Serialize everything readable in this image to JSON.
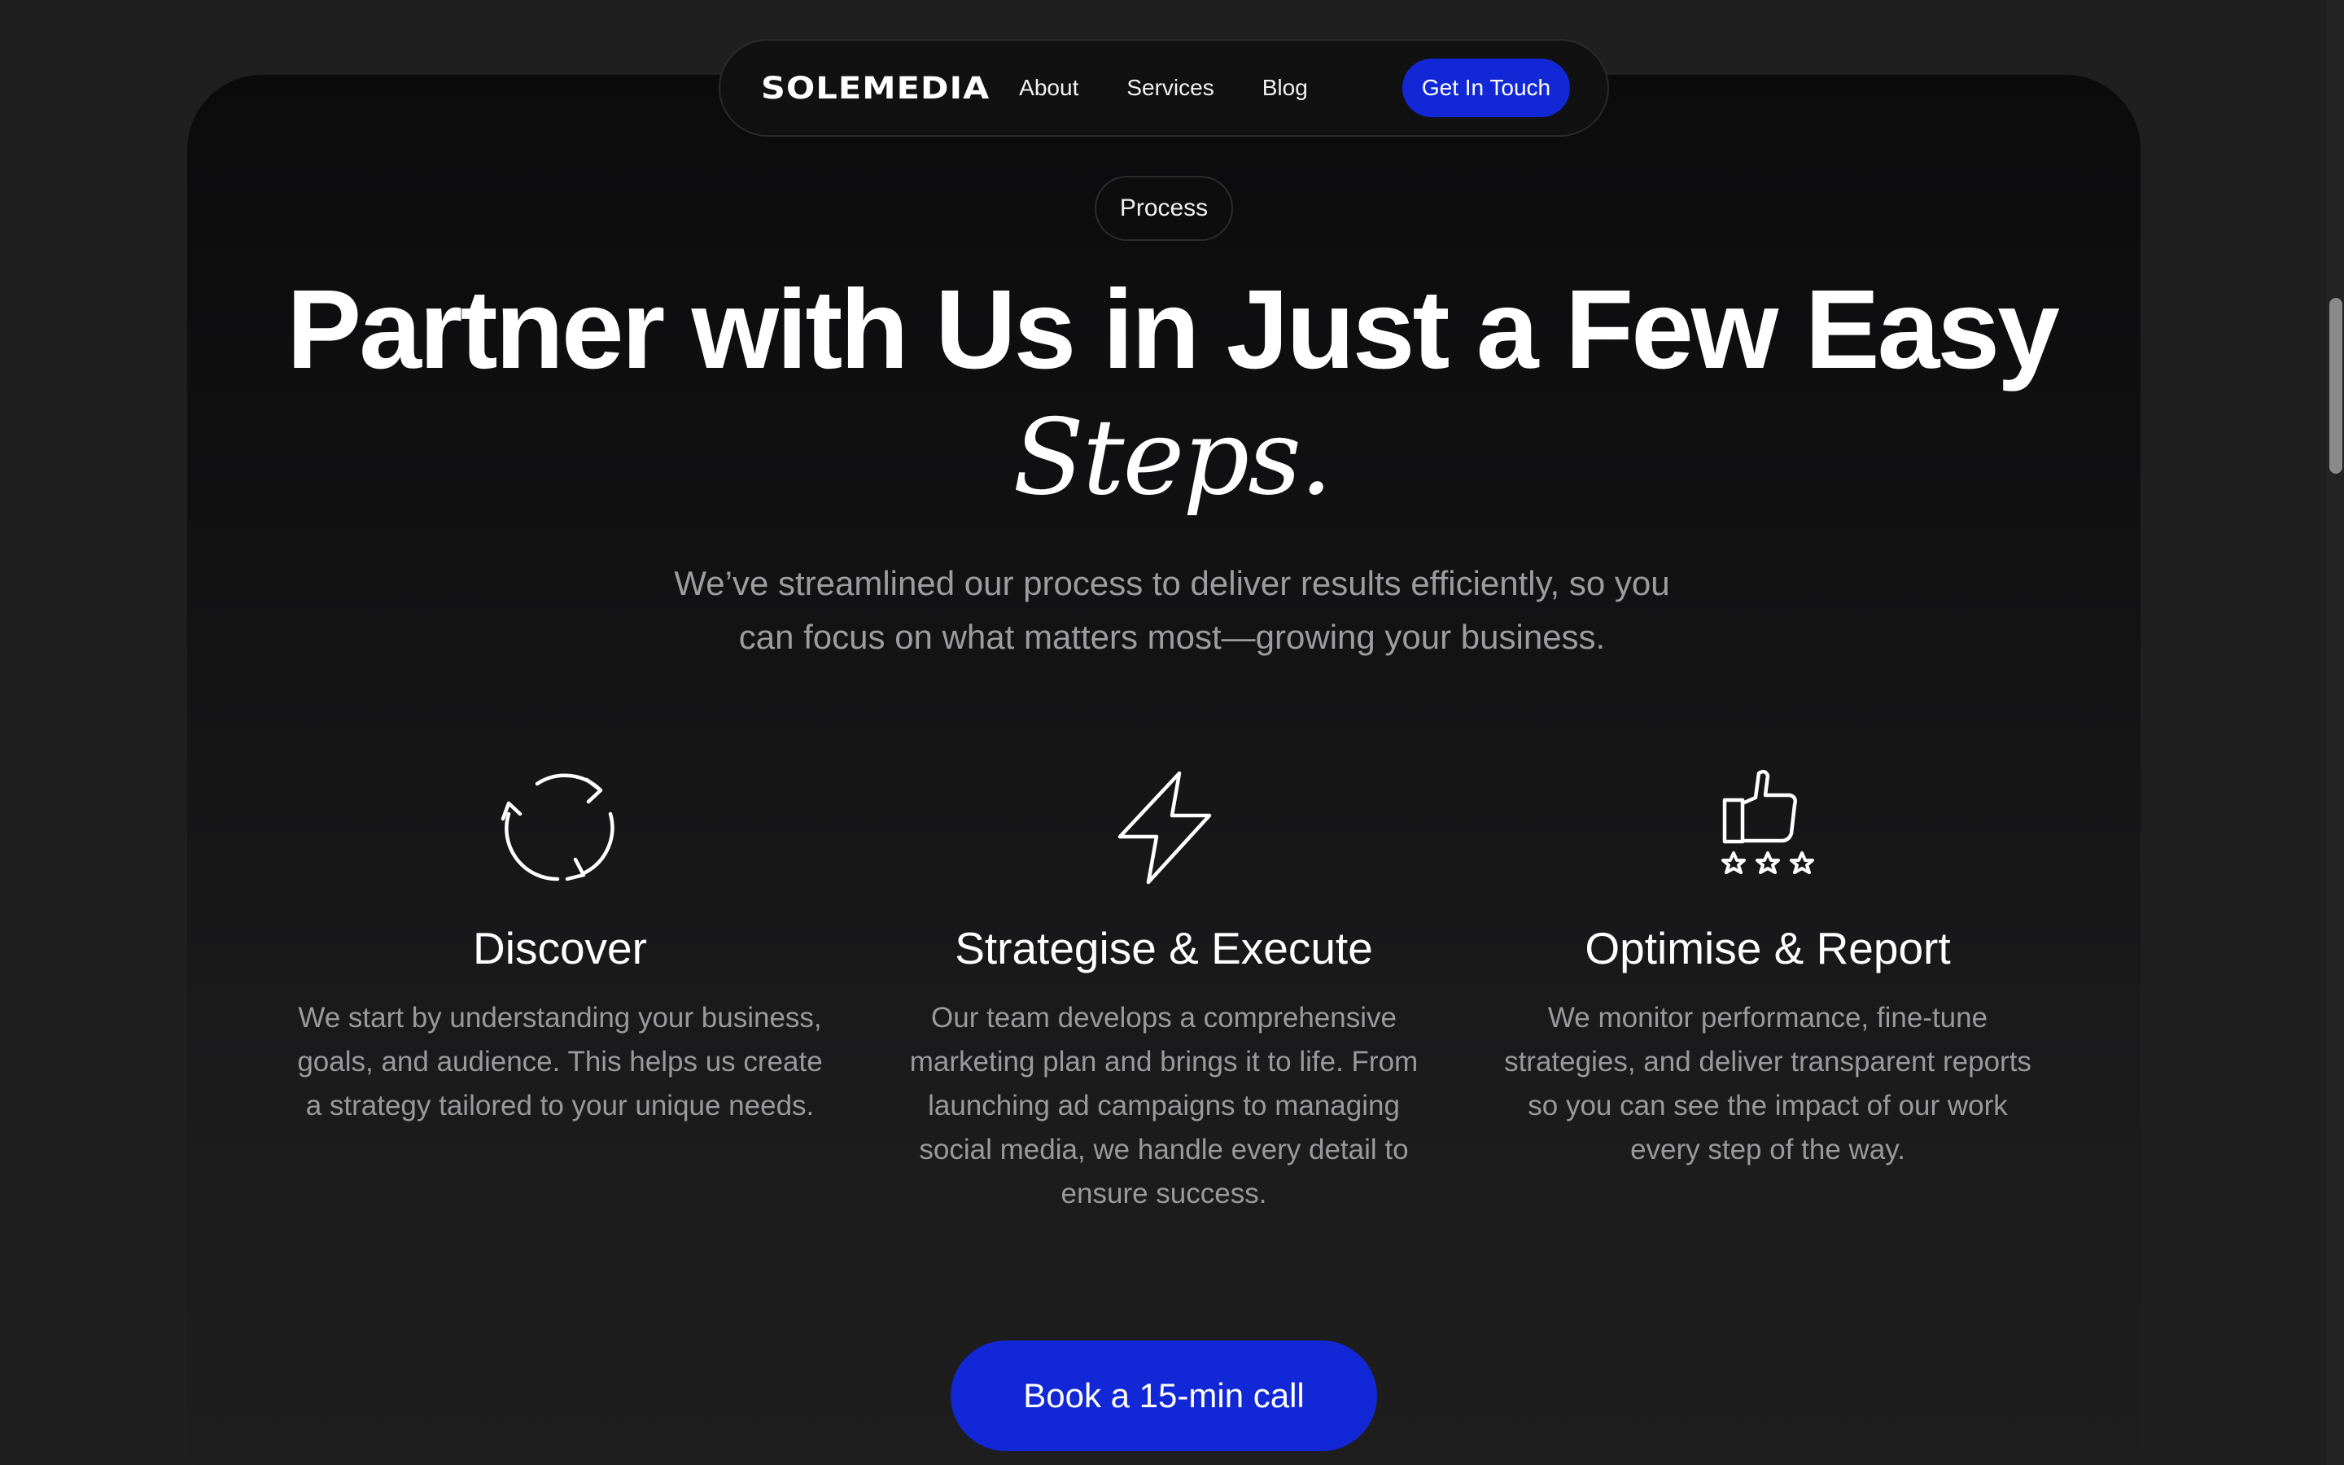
{
  "nav": {
    "logo": "SOLEMEDIA",
    "links": [
      "About",
      "Services",
      "Blog"
    ],
    "cta": "Get In Touch"
  },
  "section_label": "Process",
  "headline": "Partner with Us in Just a Few Easy",
  "headline_italic": "Steps.",
  "subhead": "We’ve streamlined our process to deliver results efficiently, so you can focus on what matters most—growing your business.",
  "steps": [
    {
      "icon": "refresh-cycle-icon",
      "title": "Discover",
      "text": "We start by understanding your business, goals, and audience. This helps us create a strategy tailored to your unique needs."
    },
    {
      "icon": "lightning-bolt-icon",
      "title": "Strategise & Execute",
      "text": "Our team develops a comprehensive marketing plan and brings it to life. From launching ad campaigns to managing social media, we handle every detail to ensure success."
    },
    {
      "icon": "thumbs-up-stars-icon",
      "title": "Optimise & Report",
      "text": "We monitor performance, fine-tune strategies, and deliver transparent reports so you can see the impact of our work every step of the way."
    }
  ],
  "book_cta": "Book a 15-min call",
  "colors": {
    "accent": "#1228d6",
    "background": "#1f1f1f",
    "muted_text": "#9d9d9f"
  }
}
